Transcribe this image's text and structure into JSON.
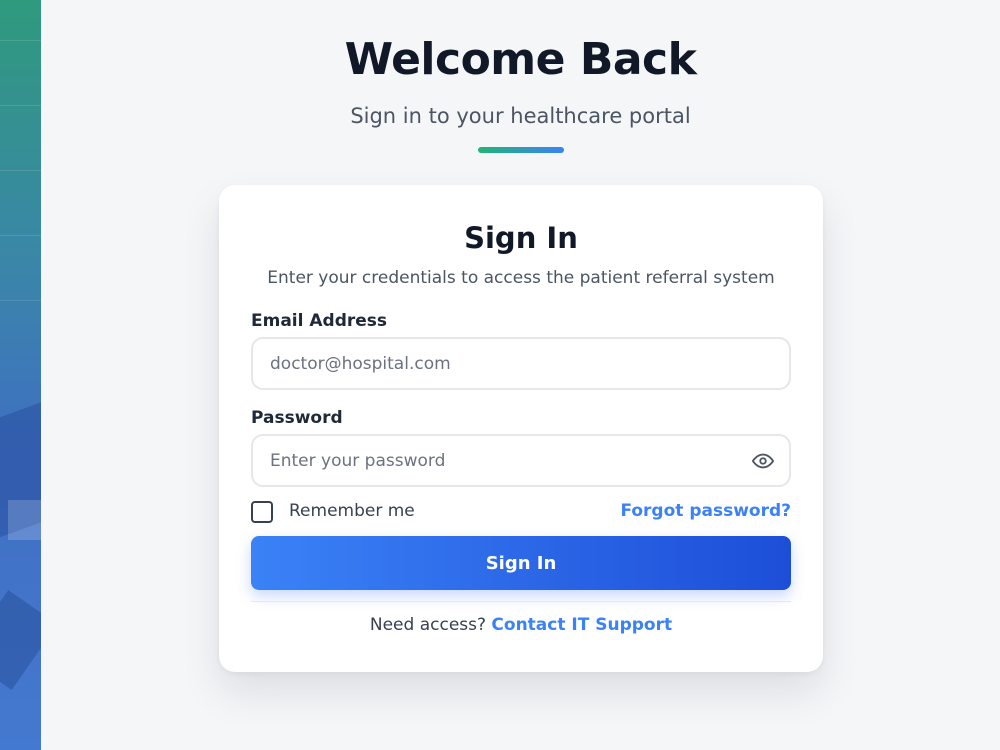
{
  "header": {
    "title": "Welcome Back",
    "subtitle": "Sign in to your healthcare portal"
  },
  "card": {
    "title": "Sign In",
    "subtitle": "Enter your credentials to access the patient referral system",
    "email": {
      "label": "Email Address",
      "placeholder": "doctor@hospital.com",
      "value": ""
    },
    "password": {
      "label": "Password",
      "placeholder": "Enter your password",
      "value": "",
      "toggle_icon": "eye-icon"
    },
    "remember": {
      "label": "Remember me",
      "checked": false
    },
    "forgot_label": "Forgot password?",
    "submit_label": "Sign In",
    "footer": {
      "prompt": "Need access?",
      "link_label": "Contact IT Support"
    }
  },
  "colors": {
    "accent": "#3b82f6",
    "button_start": "#3b82f6",
    "button_end": "#1d4ed8",
    "accent_bar_start": "#22b573",
    "accent_bar_end": "#3b82f6"
  }
}
